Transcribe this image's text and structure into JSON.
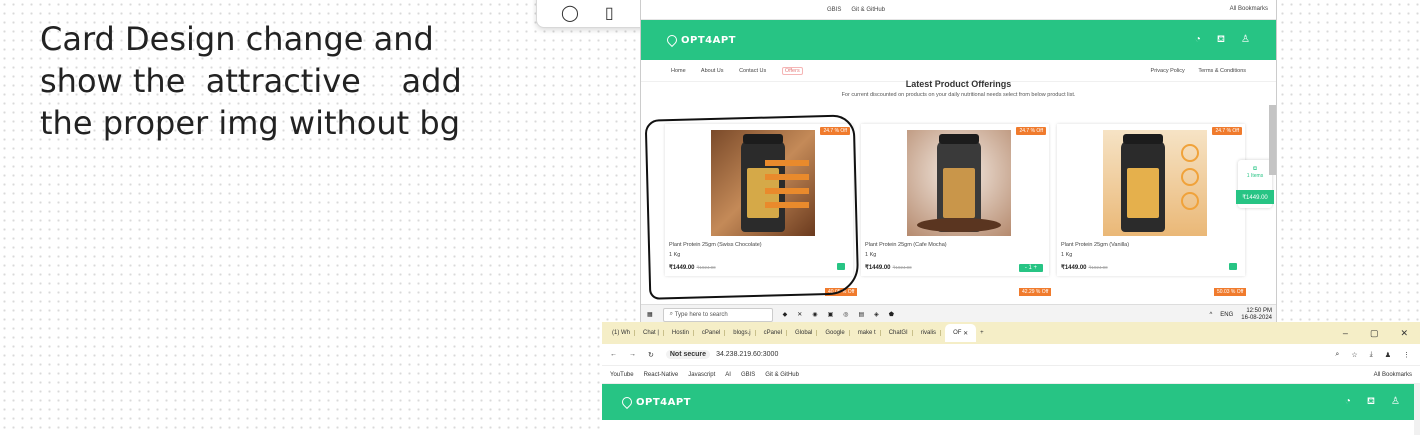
{
  "note": {
    "lines": [
      "Card Design change and",
      "show the  attractive    add",
      "the proper img without bg"
    ]
  },
  "shot1": {
    "bookmarks": [
      "GBIS",
      "Git & GitHub"
    ],
    "all_bookmarks": "All Bookmarks",
    "brand": "OPT4APT",
    "nav_left": [
      "Home",
      "About Us",
      "Contact Us",
      "Offers"
    ],
    "nav_right": [
      "Privacy Policy",
      "Terms & Conditions"
    ],
    "section_title": "Latest Product Offerings",
    "section_sub": "For current discounted on products on your daily nutritional needs select from below product list.",
    "products": [
      {
        "badge": "24.7 % Off",
        "name": "Plant Protein 25gm (Swiss Chocolate)",
        "weight": "1 Kg",
        "price": "₹1449.00",
        "old_price": "₹1924.00",
        "action": "cart"
      },
      {
        "badge": "24.7 % Off",
        "name": "Plant Protein 25gm (Cafe Mocha)",
        "weight": "1 Kg",
        "price": "₹1449.00",
        "old_price": "₹1924.00",
        "action": "- 1 +"
      },
      {
        "badge": "24.7 % Off",
        "name": "Plant Protein 25gm (Vanilla)",
        "weight": "1 Kg",
        "price": "₹1449.00",
        "old_price": "₹1924.00",
        "action": "cart"
      }
    ],
    "next_badges": [
      "40.05 % Off",
      "42.29 % Off",
      "50.03 % Off"
    ],
    "floating_cart": {
      "items": "1 Items",
      "total": "₹1449.00"
    },
    "taskbar": {
      "search_placeholder": "Type here to search",
      "lang": "ENG",
      "time": "12:50 PM",
      "date": "16-08-2024"
    }
  },
  "shot2": {
    "tabs": [
      "(1) Wh",
      "Chat |",
      "Hostin",
      "cPanel",
      "blogs.j",
      "cPanel",
      "Global",
      "Google",
      "make t",
      "ChatGI",
      "rivalis"
    ],
    "active_tab": "OF",
    "address_status": "Not secure",
    "address_url": "34.238.219.60:3000",
    "bookmarks": [
      "YouTube",
      "React-Native",
      "Javascript",
      "AI",
      "GBIS",
      "Git & GitHub"
    ],
    "all_bookmarks": "All Bookmarks",
    "brand": "OPT4APT"
  }
}
